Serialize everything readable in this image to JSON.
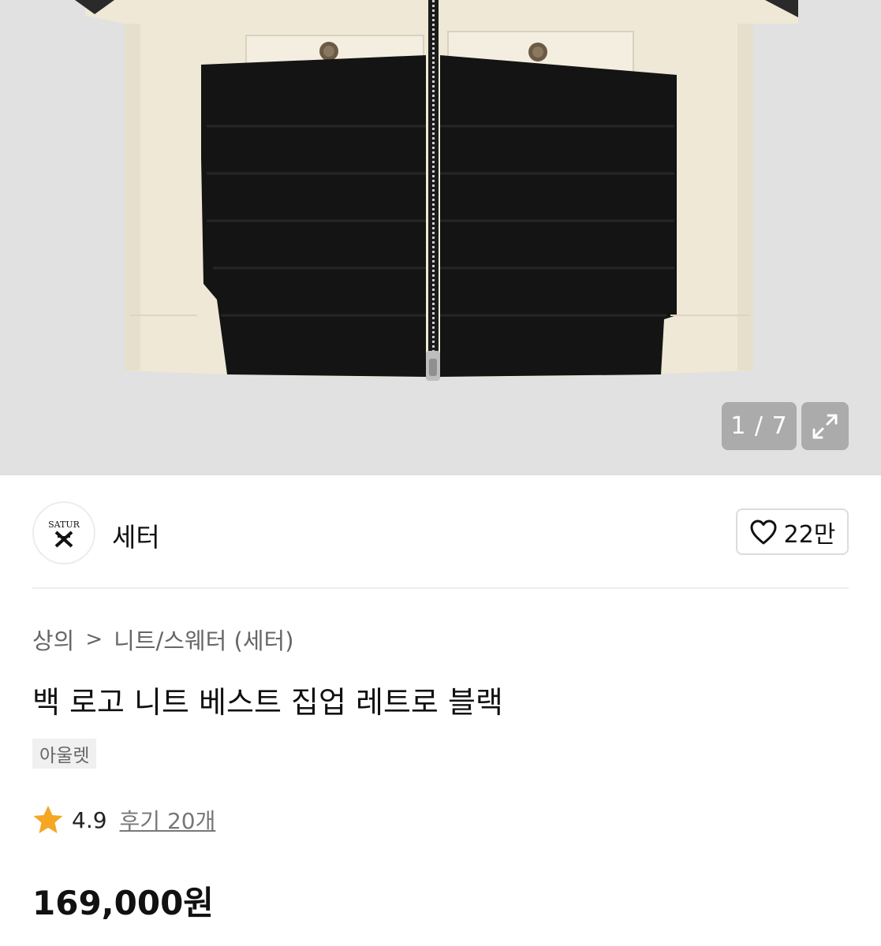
{
  "gallery": {
    "counter": "1 / 7",
    "expand_icon": "expand-icon"
  },
  "brand": {
    "logo_text": "SATUR",
    "name": "세터",
    "like_icon": "heart-icon",
    "like_count": "22만"
  },
  "breadcrumb": {
    "category": "상의",
    "separator": ">",
    "subcategory": "니트/스웨터 (세터)"
  },
  "product": {
    "title": "백 로고 니트 베스트 집업 레트로 블랙",
    "tag": "아울렛",
    "rating": "4.9",
    "review_link": "후기 20개",
    "price": "169,000원"
  },
  "colors": {
    "star": "#f5a623",
    "gallery_background": "#e1e1e1",
    "knit_cream": "#efe8d6",
    "knit_black": "#141414"
  }
}
